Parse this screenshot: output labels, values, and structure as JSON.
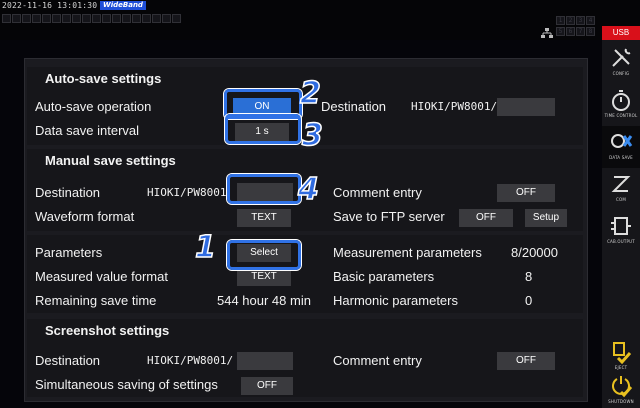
{
  "status": {
    "timestamp": "2022-11-16 13:01:30",
    "mode_badge": "WideBand",
    "usb_label": "USB",
    "channels_top": [
      "1",
      "2",
      "3",
      "4"
    ],
    "channels_bottom": [
      "5",
      "6",
      "7",
      "8"
    ]
  },
  "sidebar": [
    {
      "id": "config",
      "caption": "CONFIG",
      "icon": "wrench-screwdriver-icon"
    },
    {
      "id": "time",
      "caption": "TIME CONTROL",
      "icon": "stopwatch-icon"
    },
    {
      "id": "datasave",
      "caption": "DATA SAVE",
      "icon": "data-save-icon"
    },
    {
      "id": "com",
      "caption": "COM",
      "icon": "com-icon"
    },
    {
      "id": "cab",
      "caption": "CAB.OUTPUT",
      "icon": "cable-output-icon"
    },
    {
      "id": "eject",
      "caption": "EJECT",
      "icon": "eject-icon"
    },
    {
      "id": "shutdown",
      "caption": "SHUTDOWN",
      "icon": "shutdown-icon"
    }
  ],
  "auto_save": {
    "heading": "Auto-save settings",
    "operation_label": "Auto-save operation",
    "operation_value": "ON",
    "destination_label": "Destination",
    "destination_value": "HIOKI/PW8001/",
    "interval_label": "Data save interval",
    "interval_value": "1 s"
  },
  "manual_save": {
    "heading": "Manual save settings",
    "destination_label": "Destination",
    "destination_value": "HIOKI/PW8001",
    "comment_label": "Comment entry",
    "comment_value": "OFF",
    "waveform_label": "Waveform format",
    "waveform_value": "TEXT",
    "ftp_label": "Save to FTP server",
    "ftp_value": "OFF",
    "setup_label": "Setup"
  },
  "parameters": {
    "params_label": "Parameters",
    "select_label": "Select",
    "value_format_label": "Measured value format",
    "value_format_value": "TEXT",
    "remaining_label": "Remaining save time",
    "remaining_value": "544 hour 48 min",
    "measurement_label": "Measurement parameters",
    "measurement_value": "8/20000",
    "basic_label": "Basic parameters",
    "basic_value": "8",
    "harmonic_label": "Harmonic parameters",
    "harmonic_value": "0"
  },
  "screenshot": {
    "heading": "Screenshot settings",
    "destination_label": "Destination",
    "destination_value": "HIOKI/PW8001/",
    "comment_label": "Comment entry",
    "comment_value": "OFF",
    "simultaneous_label": "Simultaneous saving of settings",
    "simultaneous_value": "OFF"
  },
  "callouts": [
    "1",
    "2",
    "3",
    "4"
  ],
  "colors": {
    "accent": "#2f6be0",
    "usb": "#d9101a",
    "button_on": "#2a6fd6"
  }
}
